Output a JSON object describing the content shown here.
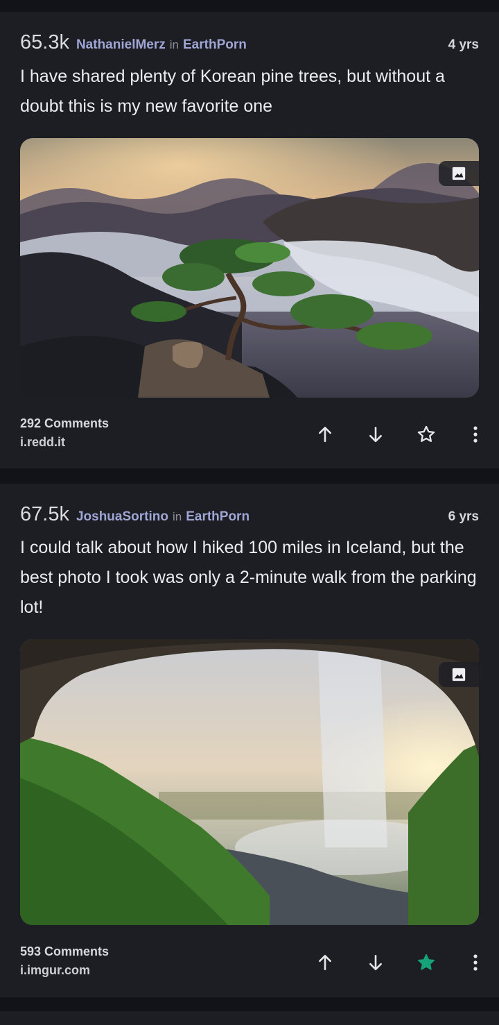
{
  "posts": [
    {
      "score": "65.3k",
      "author": "NathanielMerz",
      "in_label": "in",
      "subreddit": "EarthPorn",
      "age": "4 yrs",
      "title": "I have shared plenty of Korean pine trees, but without a doubt this is my new favorite one",
      "comments": "292 Comments",
      "domain": "i.redd.it",
      "saved": false
    },
    {
      "score": "67.5k",
      "author": "JoshuaSortino",
      "in_label": "in",
      "subreddit": "EarthPorn",
      "age": "6 yrs",
      "title": "I could talk about how I hiked 100 miles in Iceland, but the best photo I took was only a 2-minute walk from the parking lot!",
      "comments": "593 Comments",
      "domain": "i.imgur.com",
      "saved": true
    }
  ],
  "colors": {
    "background": "#121318",
    "card": "#1d1e24",
    "link_accent": "#9fa6d4",
    "saved_star": "#16a37a"
  },
  "icons": {
    "upvote": "arrow-up-icon",
    "downvote": "arrow-down-icon",
    "save": "star-icon",
    "more": "more-vertical-icon",
    "image_badge": "image-icon"
  }
}
